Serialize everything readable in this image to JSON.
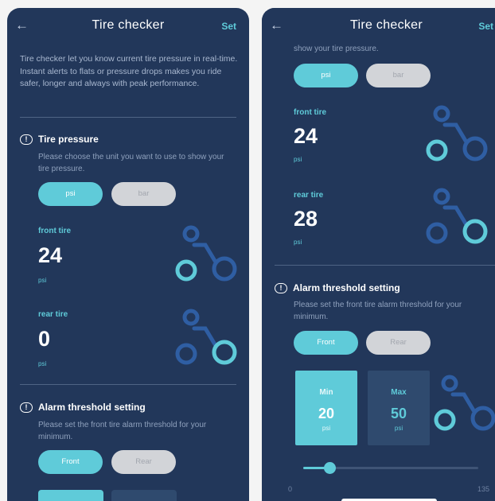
{
  "colors": {
    "background": "#22375a",
    "accent": "#5fcbd9",
    "pill_off": "#d2d4d8",
    "text_muted": "#a9b8d0"
  },
  "screen1": {
    "header": {
      "back_icon": "arrow-left-icon",
      "title": "Tire checker",
      "set_label": "Set"
    },
    "intro": "Tire checker let you know current tire pressure in real-time. Instant alerts to flats or pressure drops makes you ride safer, longer and always with peak performance.",
    "pressure": {
      "title": "Tire pressure",
      "icon": "alert-icon",
      "description": "Please choose the unit you want to use to show your tire pressure.",
      "unit_psi": "psi",
      "unit_bar": "bar",
      "front_label": "front tire",
      "front_value": "24",
      "front_unit": "psi",
      "rear_label": "rear tire",
      "rear_value": "0",
      "rear_unit": "psi"
    },
    "alarm": {
      "title": "Alarm threshold setting",
      "icon": "alert-icon",
      "description": "Please set the front tire alarm threshold for your minimum.",
      "front_label": "Front",
      "rear_label": "Rear"
    }
  },
  "screen2": {
    "header": {
      "back_icon": "arrow-left-icon",
      "title": "Tire checker",
      "set_label": "Set"
    },
    "partial_desc": "show your tire pressure.",
    "unit_psi": "psi",
    "unit_bar": "bar",
    "front_label": "front tire",
    "front_value": "24",
    "front_unit": "psi",
    "rear_label": "rear tire",
    "rear_value": "28",
    "rear_unit": "psi",
    "alarm": {
      "title": "Alarm threshold setting",
      "description": "Please set the front tire alarm threshold for your minimum.",
      "front_label": "Front",
      "rear_label": "Rear",
      "min_label": "Min",
      "min_value": "20",
      "min_unit": "psi",
      "max_label": "Max",
      "max_value": "50",
      "max_unit": "psi",
      "slider_min": "0",
      "slider_max": "135",
      "slider_fraction": 0.15
    }
  }
}
